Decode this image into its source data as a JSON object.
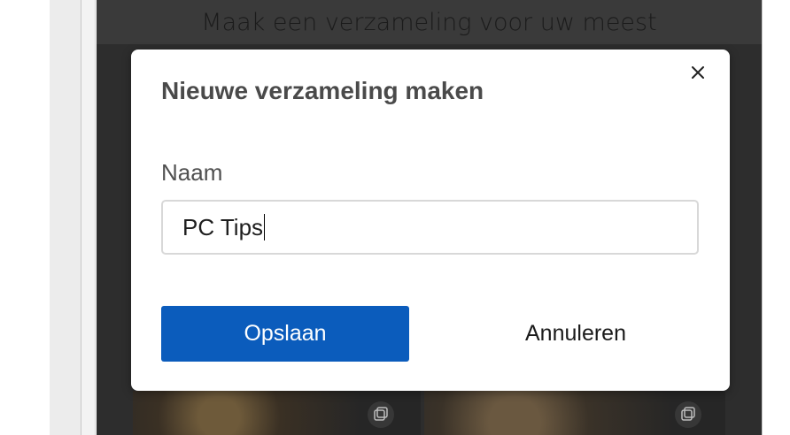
{
  "background": {
    "heading": "Maak een verzameling voor uw meest"
  },
  "dialog": {
    "title": "Nieuwe verzameling maken",
    "name_label": "Naam",
    "name_value": "PC Tips",
    "save_label": "Opslaan",
    "cancel_label": "Annuleren",
    "close_icon": "close-icon"
  },
  "colors": {
    "primary": "#0b5cbc",
    "dim_overlay": "#2d2d2d"
  }
}
